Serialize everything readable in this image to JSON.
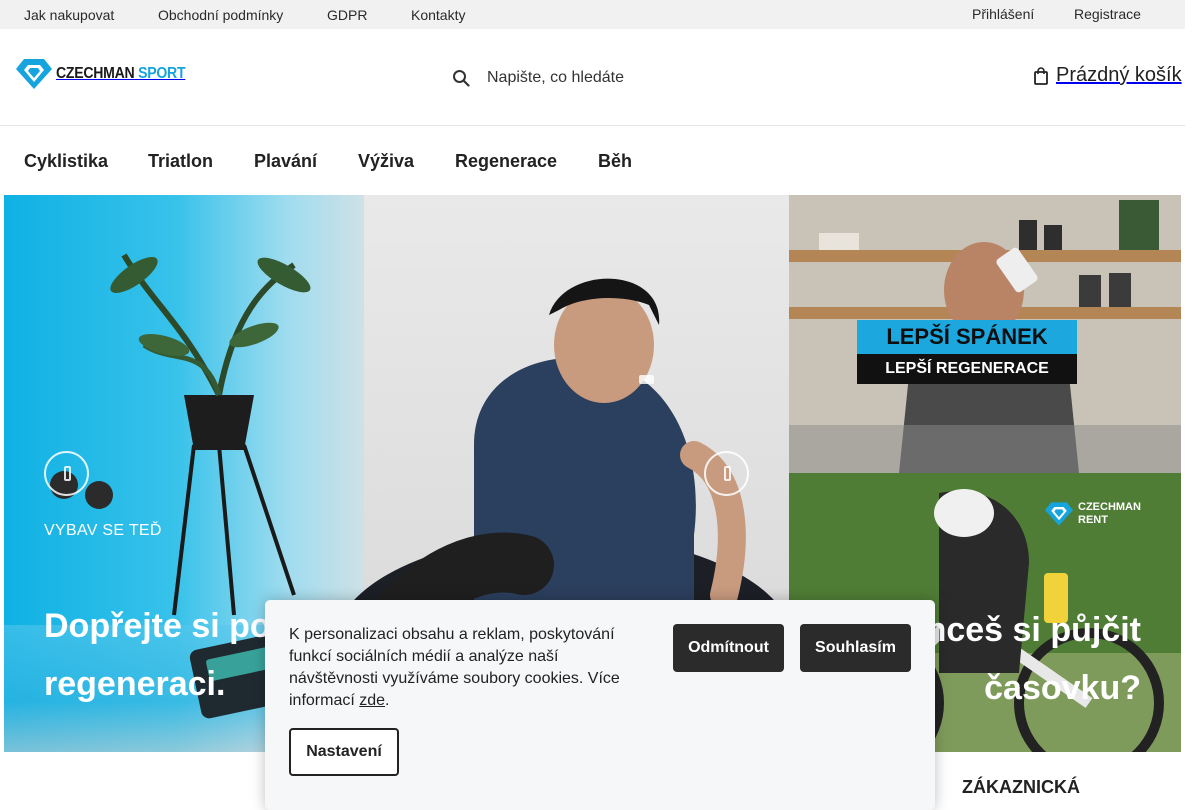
{
  "topbar": {
    "links": [
      "Jak nakupovat",
      "Obchodní podmínky",
      "GDPR",
      "Kontakty"
    ],
    "login": "Přihlášení",
    "register": "Registrace"
  },
  "header": {
    "logo_word_1": "CZECHMAN",
    "logo_word_2": "SPORT",
    "search_placeholder": "Napište, co hledáte",
    "cart_label": "Prázdný košík"
  },
  "nav": {
    "items": [
      "Cyklistika",
      "Triatlon",
      "Plavání",
      "Výživa",
      "Regenerace",
      "Běh"
    ]
  },
  "hero": {
    "kicker": "VYBAV SE TEĎ",
    "title": "Dopřejte si pořádnou regeneraci."
  },
  "promo_sleep": {
    "line1": "LEPŠÍ SPÁNEK",
    "line2": "LEPŠÍ REGENERACE"
  },
  "promo_rent": {
    "logo_line1": "CZECHMAN",
    "logo_line2": "RENT",
    "title": "Chceš si půjčit časovku?"
  },
  "below": {
    "right_heading": "ZÁKAZNICKÁ"
  },
  "cookie": {
    "text": "K personalizaci obsahu a reklam, poskytování funkcí sociálních médií a analýze naší návštěvnosti využíváme soubory cookies. Více informací ",
    "link": "zde",
    "text_end": ".",
    "decline": "Odmítnout",
    "accept": "Souhlasím",
    "settings": "Nastavení"
  },
  "colors": {
    "brand_blue": "#16a4de",
    "dark_button": "#2b2b2b",
    "topbar_bg": "#f1f1f1"
  }
}
